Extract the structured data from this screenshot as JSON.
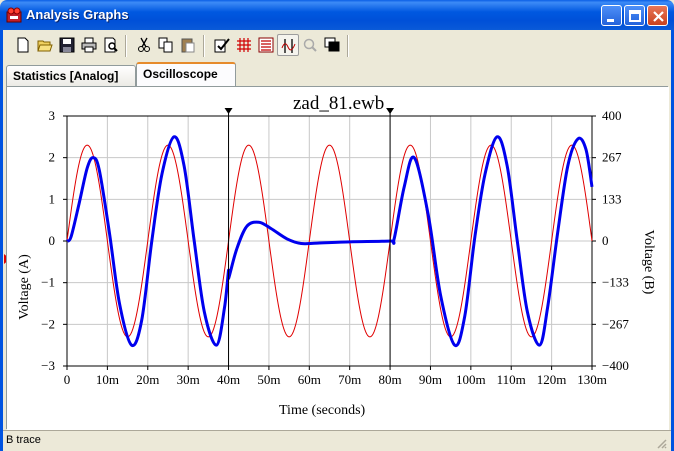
{
  "window": {
    "title": "Analysis Graphs",
    "icon": "app-graph-icon"
  },
  "toolbar": {
    "buttons": [
      "new-icon",
      "open-icon",
      "save-icon",
      "print-icon",
      "print-preview-icon",
      "cut-icon",
      "copy-icon",
      "paste-icon",
      "properties-icon",
      "toggle-grid-icon",
      "toggle-legend-icon",
      "toggle-cursors-icon",
      "zoom-icon",
      "restore-graph-icon"
    ]
  },
  "tabs": [
    {
      "label": "Statistics [Analog]",
      "active": false
    },
    {
      "label": "Oscilloscope",
      "active": true
    }
  ],
  "status": {
    "text": "B trace"
  },
  "colors": {
    "trace_a": "#e00000",
    "trace_b": "#0000ee",
    "grid": "#c8c8c8"
  },
  "chart_data": {
    "type": "line",
    "title": "zad_81.ewb",
    "xlabel": "Time (seconds)",
    "ylabel_left": "Voltage (A)",
    "ylabel_right": "Voltage (B)",
    "xlim": [
      0,
      0.13
    ],
    "ylim_left": [
      -3,
      3
    ],
    "ylim_right": [
      -400,
      400
    ],
    "x_ticks": [
      "0",
      "10m",
      "20m",
      "30m",
      "40m",
      "50m",
      "60m",
      "70m",
      "80m",
      "90m",
      "100m",
      "110m",
      "120m",
      "130m"
    ],
    "y_ticks_left": [
      "3",
      "2",
      "1",
      "0",
      "−1",
      "−2",
      "−3"
    ],
    "y_ticks_right": [
      "400",
      "267",
      "133",
      "0",
      "−133",
      "−267",
      "−400"
    ],
    "grid": true,
    "cursors": [
      0.04,
      0.08
    ],
    "series": [
      {
        "axis": "left",
        "color": "#e00000",
        "x": [
          0,
          0.0025,
          0.005,
          0.0075,
          0.01,
          0.0125,
          0.015,
          0.0175,
          0.02,
          0.0225,
          0.025,
          0.0275,
          0.03,
          0.0325,
          0.035,
          0.0375,
          0.04,
          0.0425,
          0.045,
          0.0475,
          0.05,
          0.0525,
          0.055,
          0.0575,
          0.06,
          0.0625,
          0.065,
          0.0675,
          0.07,
          0.0725,
          0.075,
          0.0775,
          0.08,
          0.0825,
          0.085,
          0.0875,
          0.09,
          0.0925,
          0.095,
          0.0975,
          0.1,
          0.1025,
          0.105,
          0.1075,
          0.11,
          0.1125,
          0.115,
          0.1175,
          0.12,
          0.1225,
          0.125,
          0.1275,
          0.13
        ],
        "y": [
          0,
          1.63,
          2.3,
          1.63,
          0,
          -1.63,
          -2.3,
          -1.63,
          0,
          1.63,
          2.3,
          1.63,
          0,
          -1.63,
          -2.3,
          -1.63,
          0,
          1.63,
          2.3,
          1.63,
          0,
          -1.63,
          -2.3,
          -1.63,
          0,
          1.63,
          2.3,
          1.63,
          0,
          -1.63,
          -2.3,
          -1.63,
          0,
          1.63,
          2.3,
          1.63,
          0,
          -1.63,
          -2.3,
          -1.63,
          0,
          1.63,
          2.3,
          1.63,
          0,
          -1.63,
          -2.3,
          -1.63,
          0,
          1.63,
          2.3,
          1.63,
          0
        ]
      },
      {
        "axis": "left",
        "color": "#0000ee",
        "x": [
          0,
          0.001,
          0.003,
          0.005,
          0.0065,
          0.008,
          0.0105,
          0.013,
          0.016,
          0.0185,
          0.021,
          0.0235,
          0.0265,
          0.029,
          0.0315,
          0.034,
          0.037,
          0.039,
          0.04,
          0.04,
          0.042,
          0.0445,
          0.0475,
          0.0505,
          0.0545,
          0.058,
          0.062,
          0.07,
          0.08,
          0.081,
          0.0835,
          0.086,
          0.0895,
          0.0925,
          0.096,
          0.0985,
          0.101,
          0.1035,
          0.1065,
          0.109,
          0.1115,
          0.114,
          0.117,
          0.119,
          0.1215,
          0.124,
          0.1265,
          0.1285,
          0.13
        ],
        "y": [
          0,
          0.1,
          0.9,
          1.75,
          2.0,
          1.7,
          0.2,
          -1.5,
          -2.5,
          -1.9,
          0,
          1.6,
          2.5,
          1.8,
          0,
          -1.7,
          -2.5,
          -1.6,
          -0.7,
          -0.9,
          -0.2,
          0.35,
          0.45,
          0.3,
          0.05,
          -0.06,
          -0.05,
          -0.02,
          0,
          0.05,
          1.3,
          2.0,
          0.6,
          -1.3,
          -2.5,
          -1.8,
          0.1,
          1.6,
          2.5,
          1.8,
          0,
          -1.7,
          -2.5,
          -1.6,
          0.2,
          1.8,
          2.45,
          2.2,
          1.3
        ]
      }
    ]
  }
}
